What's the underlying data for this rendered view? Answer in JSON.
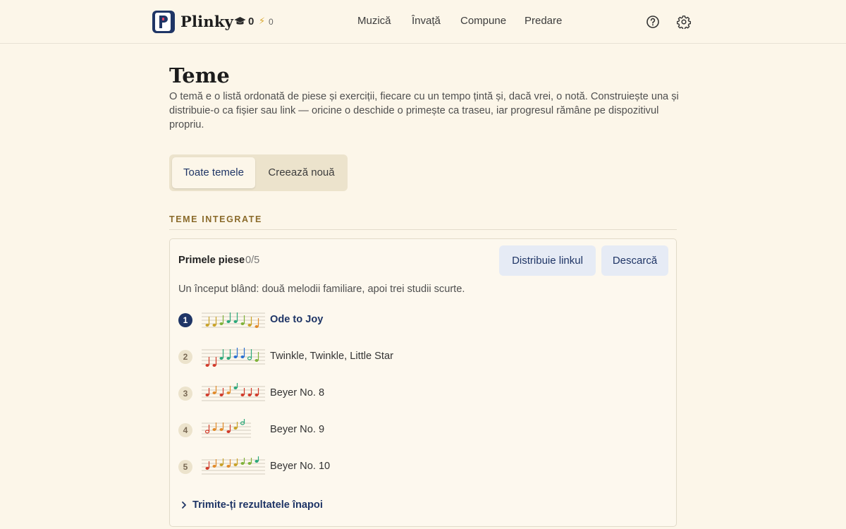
{
  "app": {
    "brand": "Plinky",
    "stats": {
      "caps": "0",
      "bolts": "0"
    }
  },
  "nav": {
    "items": [
      "Muzică",
      "Învață",
      "Compune",
      "Predare"
    ],
    "icons": [
      "help-circle-icon",
      "gear-icon"
    ]
  },
  "page": {
    "title": "Teme",
    "description": "O temă e o listă ordonată de piese și exerciții, fiecare cu un tempo țintă și, dacă vrei, o notă. Construiește una și distribuie-o ca fișier sau link — oricine o deschide o primește ca traseu, iar progresul rămâne pe dispozitivul propriu."
  },
  "tabs": {
    "all": "Toate temele",
    "create": "Creează nouă"
  },
  "section": {
    "heading": "TEME INTEGRATE"
  },
  "card": {
    "title": "Primele piese",
    "progress": "0/5",
    "share_label": "Distribuie linkul",
    "download_label": "Descarcă",
    "description": "Un început blând: două melodii familiare, apoi trei studii scurte.",
    "items": [
      {
        "number": "1",
        "title": "Ode to Joy",
        "active": true
      },
      {
        "number": "2",
        "title": "Twinkle, Twinkle, Little Star",
        "active": false
      },
      {
        "number": "3",
        "title": "Beyer No. 8",
        "active": false
      },
      {
        "number": "4",
        "title": "Beyer No. 9",
        "active": false
      },
      {
        "number": "5",
        "title": "Beyer No. 10",
        "active": false
      }
    ],
    "send_results": "Trimite-ți rezultatele înapoi"
  },
  "colors": {
    "background": "#fcf6e9",
    "accent": "#1f3566",
    "section_heading": "#8a6a2a",
    "tab_track": "#ece3cc",
    "button_bg": "#e6ebf5"
  }
}
